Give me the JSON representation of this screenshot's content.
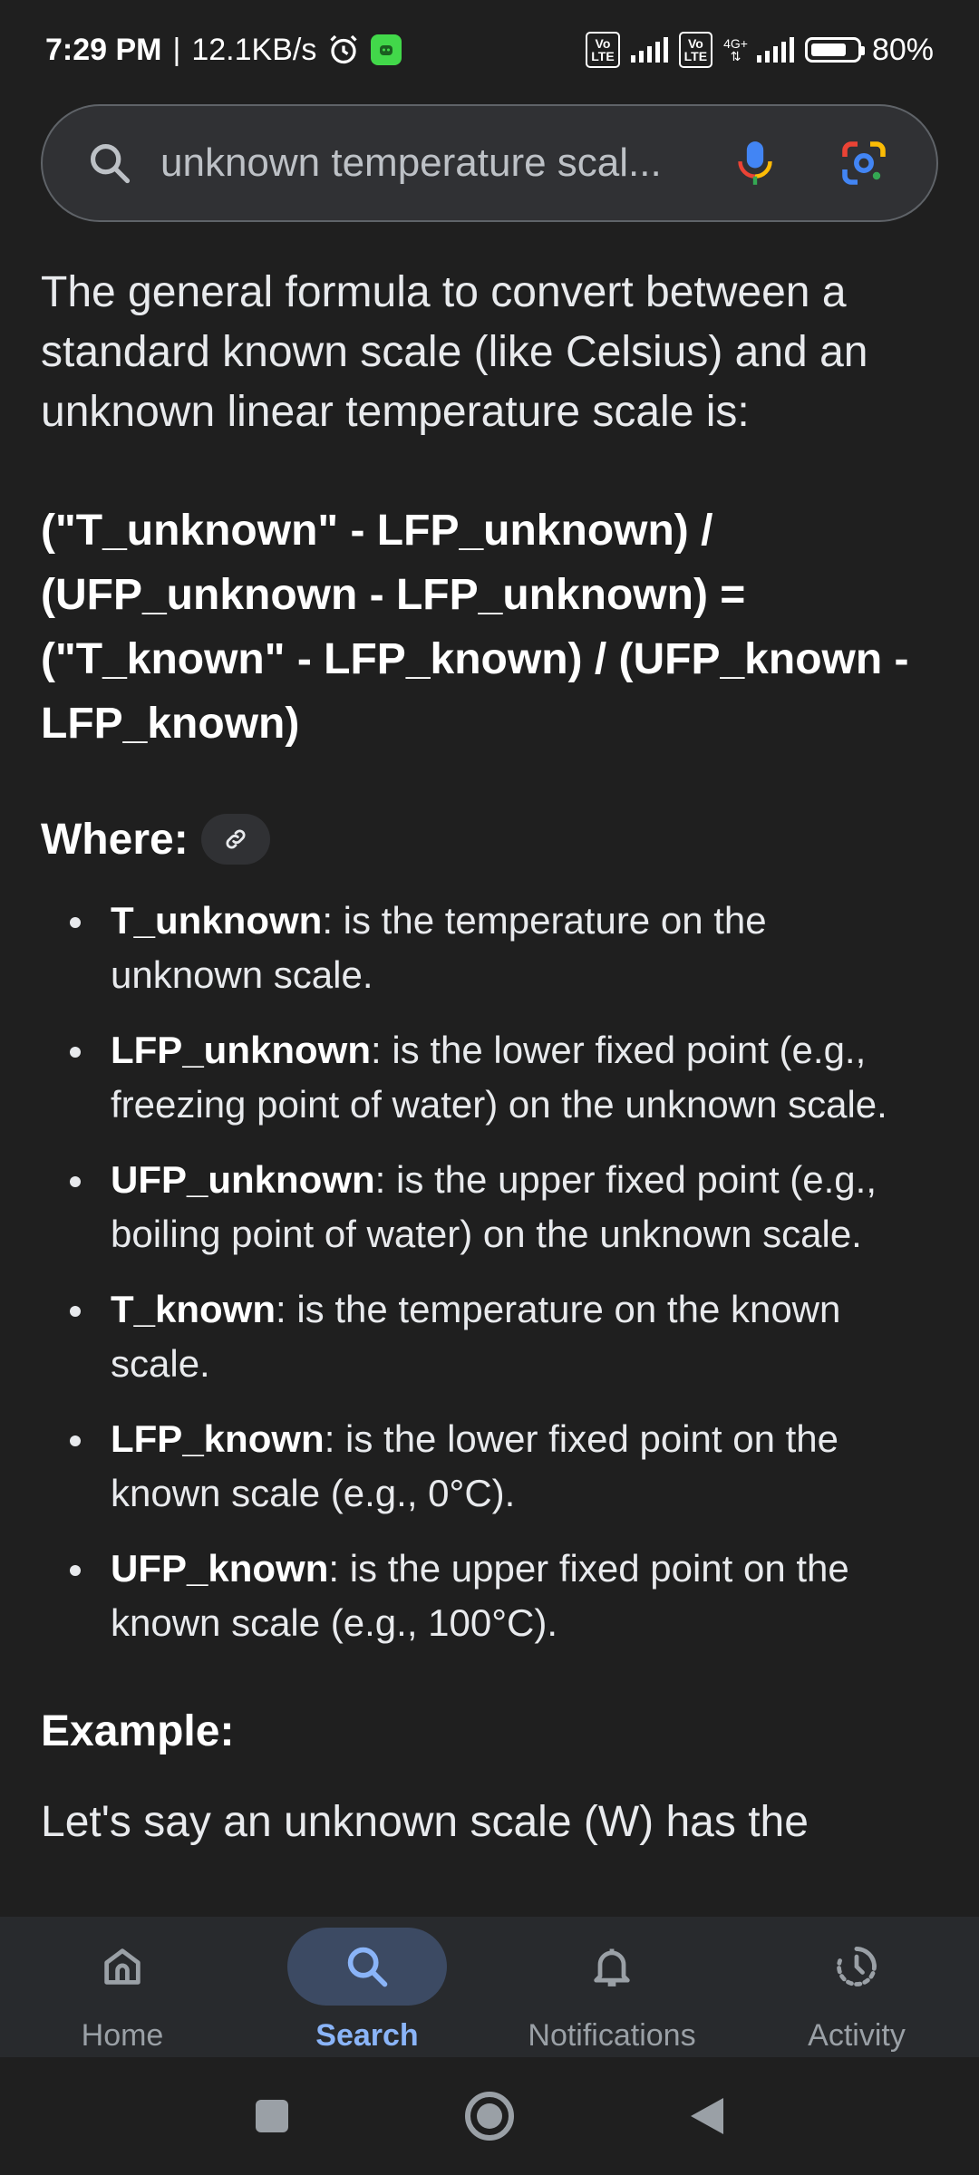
{
  "status_bar": {
    "time": "7:29 PM",
    "speed": "12.1KB/s",
    "separator": "|",
    "sim1_label_top": "Vo",
    "sim1_label_bottom": "LTE",
    "sim2_label_top": "Vo",
    "sim2_label_bottom": "LTE",
    "network_type": "4G+",
    "battery_percent": "80%",
    "battery_level": 0.8,
    "icons": [
      "alarm-icon",
      "app-notification-icon",
      "signal-icon",
      "battery-icon"
    ]
  },
  "search": {
    "query": "unknown temperature scal...",
    "icons": [
      "search-icon",
      "microphone-icon",
      "lens-icon"
    ]
  },
  "content": {
    "intro": "The general formula to convert between a standard known scale (like Celsius) and an unknown linear temperature scale is:",
    "formula_lines": [
      "(\"T_unknown\" - LFP_unknown) /",
      "(UFP_unknown - LFP_unknown) =",
      "(\"T_known\" - LFP_known) / (UFP_known -",
      "LFP_known)"
    ],
    "where_label": "Where:",
    "definitions": [
      {
        "term": "T_unknown",
        "text": ": is the temperature on the unknown scale."
      },
      {
        "term": "LFP_unknown",
        "text": ": is the lower fixed point (e.g., freezing point of water) on the unknown scale."
      },
      {
        "term": "UFP_unknown",
        "text": ": is the upper fixed point (e.g., boiling point of water) on the unknown scale."
      },
      {
        "term": "T_known",
        "text": ": is the temperature on the known scale."
      },
      {
        "term": "LFP_known",
        "text": ": is the lower fixed point on the known scale (e.g., 0°C)."
      },
      {
        "term": "UFP_known",
        "text": ": is the upper fixed point on the known scale (e.g., 100°C)."
      }
    ],
    "example_label": "Example:",
    "example_text": "Let's say an unknown scale (W) has the"
  },
  "bottom_nav": {
    "items": [
      {
        "label": "Home",
        "icon": "home-icon",
        "active": false
      },
      {
        "label": "Search",
        "icon": "search-icon",
        "active": true
      },
      {
        "label": "Notifications",
        "icon": "bell-icon",
        "active": false
      },
      {
        "label": "Activity",
        "icon": "activity-icon",
        "active": false
      }
    ]
  },
  "colors": {
    "background": "#1f1f1f",
    "search_bar": "#303134",
    "active_nav": "#8ab4f8",
    "active_pill": "#3c4a63",
    "app_badge": "#42d84a"
  }
}
